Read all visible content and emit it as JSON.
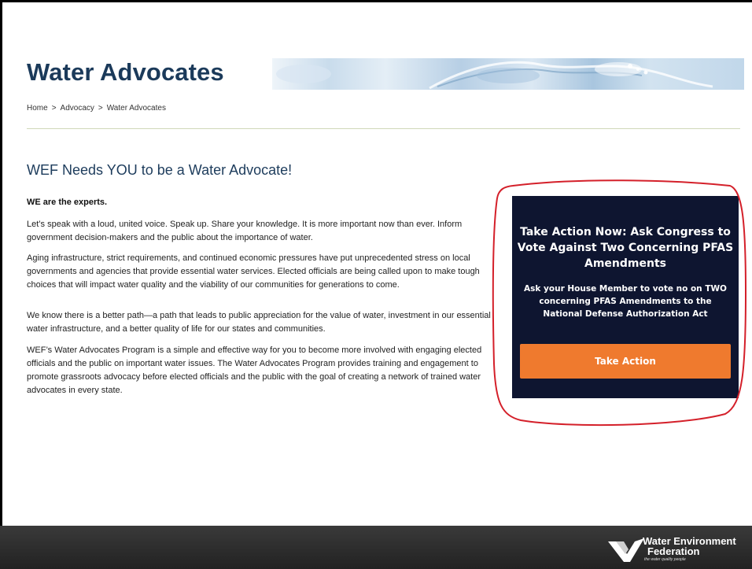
{
  "page": {
    "title": "Water Advocates",
    "breadcrumb": [
      "Home",
      ">",
      "Advocacy",
      ">",
      "Water Advocates"
    ]
  },
  "main": {
    "heading": "WEF Needs YOU to be a Water Advocate!",
    "subheading": "WE are the experts.",
    "paragraphs": [
      "Let’s speak with a loud, united voice. Speak up. Share your knowledge. It is more important now than ever. Inform government decision-makers and the public about the importance of water.",
      "Aging infrastructure, strict requirements, and continued economic pressures have put unprecedented stress on local governments and agencies that provide essential water services. Elected officials are being called upon to make tough choices that will impact water quality and the viability of our communities for generations to come.",
      "We know there is a better path—a path that leads to public appreciation for the value of water, investment in our essential water infrastructure, and a better quality of life for our states and communities.",
      "WEF’s Water Advocates Program is a simple and effective way for you to become more involved with engaging elected officials and the public on important water issues. The Water Advocates Program provides training and engagement to promote grassroots advocacy before elected officials and the public with the goal of creating a network of trained water advocates in every state."
    ]
  },
  "cta": {
    "title": "Take Action Now: Ask Congress to Vote Against Two Concerning PFAS Amendments",
    "body": "Ask your House Member to vote no on TWO concerning PFAS Amendments to the National Defense Authorization Act",
    "button_label": "Take Action"
  },
  "footer": {
    "logo_line1": "Water Environment",
    "logo_line2": "Federation",
    "logo_tagline": "the water quality people"
  },
  "colors": {
    "title": "#1b3a5a",
    "cta_background": "#0e1530",
    "cta_button": "#ef7a2e",
    "annotation": "#d4202a"
  }
}
